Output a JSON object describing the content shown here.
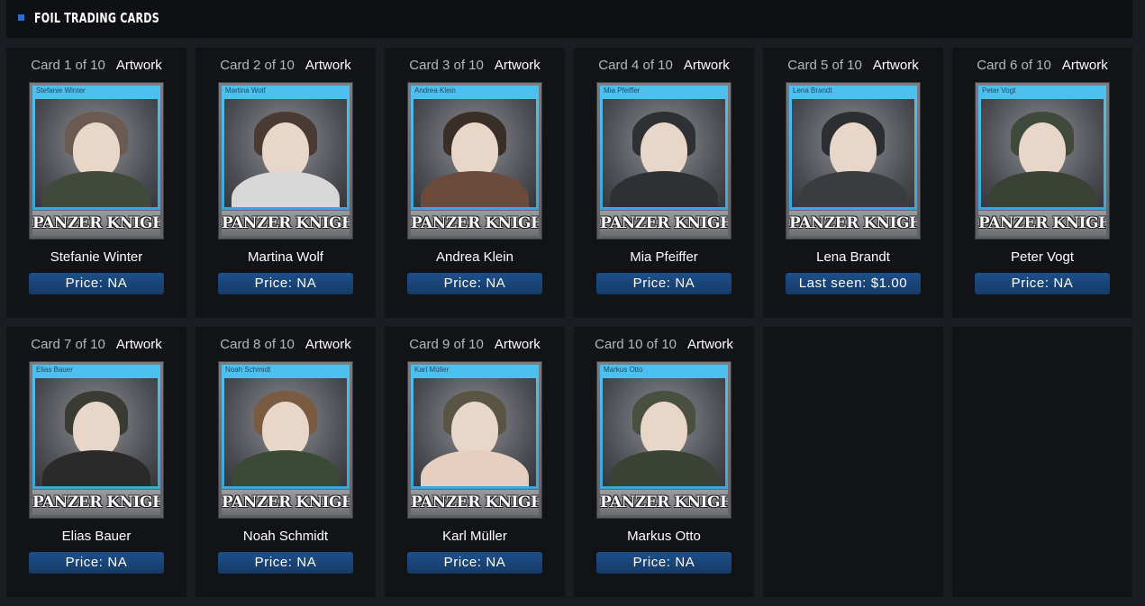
{
  "section": {
    "title": "FOIL TRADING CARDS"
  },
  "cards": [
    {
      "card_number": "Card 1 of 10",
      "artwork_label": "Artwork",
      "name": "Stefanie Winter",
      "nameplate": "Stefanie Winter",
      "logo": "PANZER KNIGHTS",
      "price": "Price: NA"
    },
    {
      "card_number": "Card 2 of 10",
      "artwork_label": "Artwork",
      "name": "Martina Wolf",
      "nameplate": "Martina Wolf",
      "logo": "PANZER KNIGHTS",
      "price": "Price: NA"
    },
    {
      "card_number": "Card 3 of 10",
      "artwork_label": "Artwork",
      "name": "Andrea Klein",
      "nameplate": "Andrea Klein",
      "logo": "PANZER KNIGHTS",
      "price": "Price: NA"
    },
    {
      "card_number": "Card 4 of 10",
      "artwork_label": "Artwork",
      "name": "Mia Pfeiffer",
      "nameplate": "Mia Pfeiffer",
      "logo": "PANZER KNIGHTS",
      "price": "Price: NA"
    },
    {
      "card_number": "Card 5 of 10",
      "artwork_label": "Artwork",
      "name": "Lena Brandt",
      "nameplate": "Lena Brandt",
      "logo": "PANZER KNIGHTS",
      "price": "Last seen: $1.00"
    },
    {
      "card_number": "Card 6 of 10",
      "artwork_label": "Artwork",
      "name": "Peter Vogt",
      "nameplate": "Peter Vogt",
      "logo": "PANZER KNIGHTS",
      "price": "Price: NA"
    },
    {
      "card_number": "Card 7 of 10",
      "artwork_label": "Artwork",
      "name": "Elias Bauer",
      "nameplate": "Elias Bauer",
      "logo": "PANZER KNIGHTS",
      "price": "Price: NA"
    },
    {
      "card_number": "Card 8 of 10",
      "artwork_label": "Artwork",
      "name": "Noah Schmidt",
      "nameplate": "Noah Schmidt",
      "logo": "PANZER KNIGHTS",
      "price": "Price: NA"
    },
    {
      "card_number": "Card 9 of 10",
      "artwork_label": "Artwork",
      "name": "Karl Müller",
      "nameplate": "Karl Müller",
      "logo": "PANZER KNIGHTS",
      "price": "Price: NA"
    },
    {
      "card_number": "Card 10 of 10",
      "artwork_label": "Artwork",
      "name": "Markus Otto",
      "nameplate": "Markus Otto",
      "logo": "PANZER KNIGHTS",
      "price": "Price: NA"
    }
  ],
  "colors": {
    "background": "#1b1d22",
    "card_background": "#121317",
    "accent_blue": "#2a6fd6",
    "nameplate_blue": "#4ec0ef",
    "price_button": "#1d4f8a"
  }
}
